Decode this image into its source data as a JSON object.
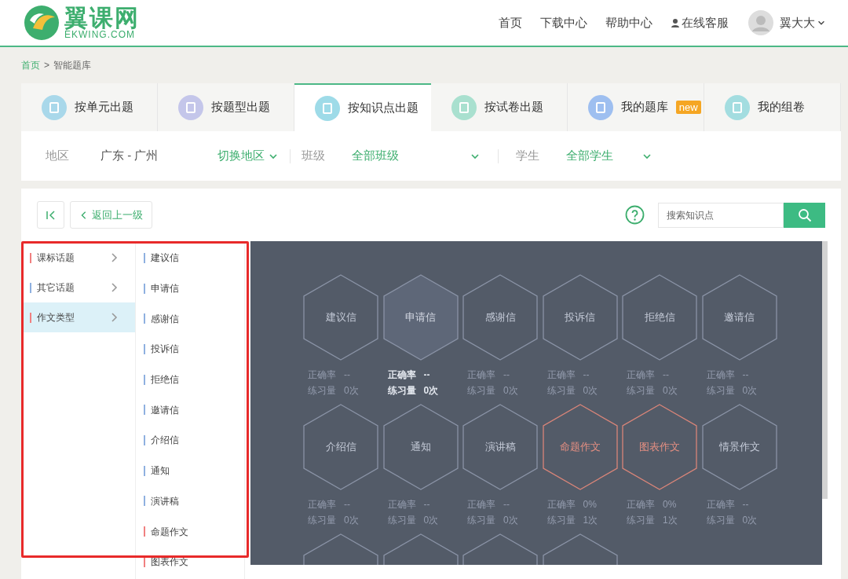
{
  "header": {
    "logo_text": "翼课网",
    "logo_sub": "EKWING.COM",
    "nav": [
      "首页",
      "下载中心",
      "帮助中心",
      "在线客服"
    ],
    "user": "翼大大"
  },
  "breadcrumb": [
    "首页",
    ">",
    "智能题库"
  ],
  "tabs": [
    {
      "label": "按单元出题",
      "selected": false,
      "color": "#a9d8ea"
    },
    {
      "label": "按题型出题",
      "selected": false,
      "color": "#c4c6ea"
    },
    {
      "label": "按知识点出题",
      "selected": true,
      "color": "#9edbe8"
    },
    {
      "label": "按试卷出题",
      "selected": false,
      "color": "#a9e0cf"
    },
    {
      "label": "我的题库",
      "selected": false,
      "color": "#9ebff0",
      "badge": "new"
    },
    {
      "label": "我的组卷",
      "selected": false,
      "color": "#a3dde0"
    }
  ],
  "filters": {
    "region_label": "地区",
    "region_value": "广东 - 广州",
    "region_switch": "切换地区",
    "class_label": "班级",
    "class_value": "全部班级",
    "student_label": "学生",
    "student_value": "全部学生"
  },
  "toolbar": {
    "back": "返回上一级",
    "search_placeholder": "搜索知识点"
  },
  "categories": [
    {
      "label": "课标话题",
      "selected": false,
      "color": "#f08080"
    },
    {
      "label": "其它话题",
      "selected": false,
      "color": "#8fb0e0"
    },
    {
      "label": "作文类型",
      "selected": true,
      "color": "#f08080"
    }
  ],
  "subcategories": [
    {
      "label": "建议信",
      "color": "#8fb0e0"
    },
    {
      "label": "申请信",
      "color": "#8fb0e0"
    },
    {
      "label": "感谢信",
      "color": "#8fb0e0"
    },
    {
      "label": "投诉信",
      "color": "#8fb0e0"
    },
    {
      "label": "拒绝信",
      "color": "#8fb0e0"
    },
    {
      "label": "邀请信",
      "color": "#8fb0e0"
    },
    {
      "label": "介绍信",
      "color": "#8fb0e0"
    },
    {
      "label": "通知",
      "color": "#8fb0e0"
    },
    {
      "label": "演讲稿",
      "color": "#8fb0e0"
    },
    {
      "label": "命题作文",
      "color": "#f08080"
    },
    {
      "label": "图表作文",
      "color": "#f08080"
    }
  ],
  "topics": [
    {
      "label": "建议信",
      "kind": "normal",
      "accuracy_label": "正确率",
      "accuracy": "--",
      "count_label": "练习量",
      "count": "0次"
    },
    {
      "label": "申请信",
      "kind": "hover",
      "accuracy_label": "正确率",
      "accuracy": "--",
      "count_label": "练习量",
      "count": "0次"
    },
    {
      "label": "感谢信",
      "kind": "normal",
      "accuracy_label": "正确率",
      "accuracy": "--",
      "count_label": "练习量",
      "count": "0次"
    },
    {
      "label": "投诉信",
      "kind": "normal",
      "accuracy_label": "正确率",
      "accuracy": "--",
      "count_label": "练习量",
      "count": "0次"
    },
    {
      "label": "拒绝信",
      "kind": "normal",
      "accuracy_label": "正确率",
      "accuracy": "--",
      "count_label": "练习量",
      "count": "0次"
    },
    {
      "label": "邀请信",
      "kind": "normal",
      "accuracy_label": "正确率",
      "accuracy": "--",
      "count_label": "练习量",
      "count": "0次"
    },
    {
      "label": "介绍信",
      "kind": "normal",
      "accuracy_label": "正确率",
      "accuracy": "--",
      "count_label": "练习量",
      "count": "0次"
    },
    {
      "label": "通知",
      "kind": "normal",
      "accuracy_label": "正确率",
      "accuracy": "--",
      "count_label": "练习量",
      "count": "0次"
    },
    {
      "label": "演讲稿",
      "kind": "normal",
      "accuracy_label": "正确率",
      "accuracy": "--",
      "count_label": "练习量",
      "count": "0次"
    },
    {
      "label": "命题作文",
      "kind": "practiced",
      "accuracy_label": "正确率",
      "accuracy": "0%",
      "count_label": "练习量",
      "count": "1次"
    },
    {
      "label": "图表作文",
      "kind": "practiced",
      "accuracy_label": "正确率",
      "accuracy": "0%",
      "count_label": "练习量",
      "count": "1次"
    },
    {
      "label": "情景作文",
      "kind": "normal",
      "accuracy_label": "正确率",
      "accuracy": "--",
      "count_label": "练习量",
      "count": "0次"
    },
    {
      "kind": "cut"
    },
    {
      "kind": "cut"
    },
    {
      "kind": "cut"
    },
    {
      "kind": "cut"
    }
  ]
}
